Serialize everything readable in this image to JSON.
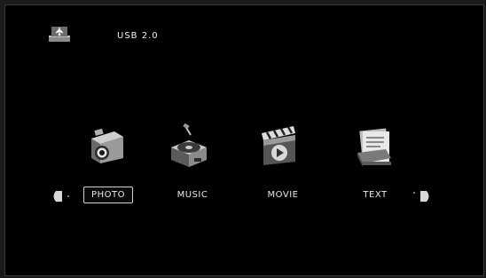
{
  "header": {
    "source_icon": "usb-drive-icon",
    "source_label": "USB 2.0"
  },
  "menu": {
    "items": [
      {
        "label": "PHOTO",
        "icon": "camera-icon",
        "selected": true
      },
      {
        "label": "MUSIC",
        "icon": "record-player-icon",
        "selected": false
      },
      {
        "label": "MOVIE",
        "icon": "clapperboard-icon",
        "selected": false
      },
      {
        "label": "TEXT",
        "icon": "documents-icon",
        "selected": false
      }
    ],
    "prev_icon": "arrow-left-icon",
    "next_icon": "arrow-right-icon"
  },
  "colors": {
    "background": "#000000",
    "text": "#e8e8e8",
    "frame": "#3a3a3a"
  }
}
